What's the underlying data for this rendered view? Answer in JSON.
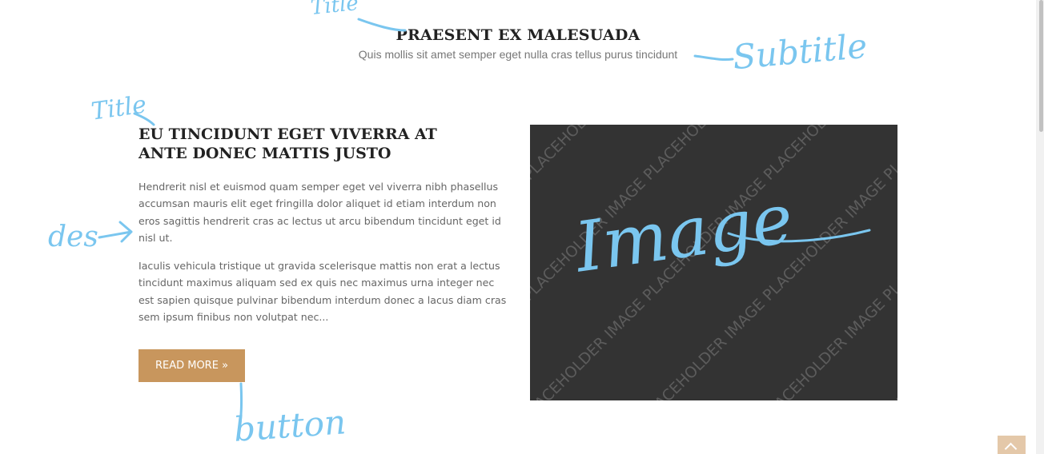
{
  "section": {
    "title": "PRAESENT EX MALESUADA",
    "subtitle": "Quis mollis sit amet semper eget nulla cras tellus purus tincidunt"
  },
  "article": {
    "title": "EU TINCIDUNT EGET VIVERRA AT ANTE DONEC MATTIS JUSTO",
    "paragraphs": [
      "Hendrerit nisl et euismod quam semper eget vel viverra nibh phasellus accumsan mauris elit eget fringilla dolor aliquet id etiam interdum non eros sagittis hendrerit cras ac lectus ut arcu bibendum tincidunt eget id nisl ut.",
      "Iaculis vehicula tristique ut gravida scelerisque mattis non erat a lectus tincidunt maximus aliquam sed ex quis nec maximus urna integer nec est sapien quisque pulvinar bibendum interdum donec a lacus diam cras sem ipsum finibus non volutpat nec..."
    ],
    "button_label": "READ MORE »"
  },
  "image": {
    "watermark_text": "IMAGE PLACEHOLDER",
    "background_color": "#333333",
    "watermark_color": "#5c5c5c"
  },
  "annotations": {
    "section_title": "Title",
    "section_subtitle": "Subtitle",
    "article_title": "Title",
    "description": "des",
    "button": "button",
    "image": "Image",
    "color": "#7ac6ef"
  },
  "colors": {
    "button_bg": "#c8965d",
    "back_to_top_bg": "#e4c8a9"
  },
  "icons": {
    "back_to_top": "chevron-up-icon",
    "arrow": "arrow-right-icon"
  }
}
